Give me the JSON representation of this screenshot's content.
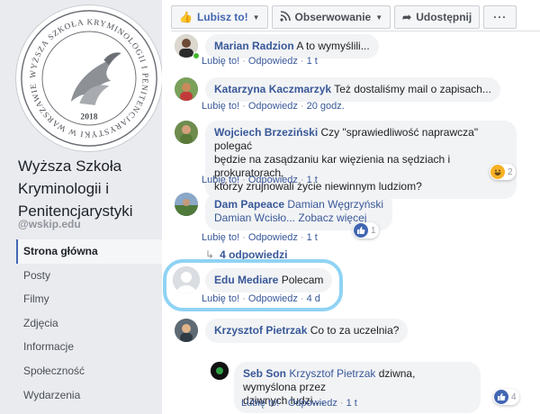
{
  "page": {
    "name": "Wyższa Szkoła Kryminologii i Penitencjarystyki",
    "handle": "@wskip.edu",
    "logo_text": "WYŻSZA SZKOŁA KRYMINOLOGII I PENITENCJARYSTYKI W WARSZAWIE",
    "logo_year": "2018"
  },
  "nav": [
    {
      "label": "Strona główna",
      "active": true
    },
    {
      "label": "Posty"
    },
    {
      "label": "Filmy"
    },
    {
      "label": "Zdjęcia"
    },
    {
      "label": "Informacje"
    },
    {
      "label": "Społeczność"
    },
    {
      "label": "Wydarzenia"
    }
  ],
  "actions": {
    "like": "Lubisz to!",
    "follow": "Obserwowanie",
    "share": "Udostępnij",
    "more": "···"
  },
  "comments": [
    {
      "author": "Marian Radzion",
      "text": "A to wymyślili...",
      "like": "Lubię to!",
      "reply": "Odpowiedz",
      "time": "1 t"
    },
    {
      "author": "Katarzyna Kaczmarzyk",
      "text": "Też dostaliśmy mail o zapisach...",
      "like": "Lubię to!",
      "reply": "Odpowiedz",
      "time": "20 godz."
    },
    {
      "author": "Wojciech Brzeziński",
      "text_l1": "Czy \"sprawiedliwość naprawcza\" polegać",
      "text_l2": "będzie na zasądzaniu kar więzienia na sędziach i prokuratorach,",
      "text_l3": "którzy zrujnowali życie niewinnym ludziom?",
      "like": "Lubię to!",
      "reply": "Odpowiedz",
      "time": "1 t",
      "reactions": "2"
    },
    {
      "author": "Dam Papeace",
      "tag1": "Damian Węgrzyński",
      "tag2": "Damian Wcisło...",
      "see_more": "Zobacz więcej",
      "like": "Lubię to!",
      "reply": "Odpowiedz",
      "time": "1 t",
      "reactions": "1"
    },
    {
      "author": "Edu Mediare",
      "text": "Polecam",
      "like": "Lubię to!",
      "reply": "Odpowiedz",
      "time": "4 d"
    },
    {
      "author": "Krzysztof Pietrzak",
      "text": "Co to za uczelnia?"
    },
    {
      "author": "Seb Son",
      "tag": "Krzysztof Pietrzak",
      "text_l1": "dziwna, wymyślona przez",
      "text_l2": "dziwnych ludzi....",
      "like": "Lubię to!",
      "reply": "Odpowiedz",
      "time": "1 t",
      "reactions": "4"
    }
  ],
  "replies_link": "4 odpowiedzi",
  "colors": {
    "link": "#385898",
    "accent": "#4267b2",
    "highlight": "#8fd3f4"
  }
}
